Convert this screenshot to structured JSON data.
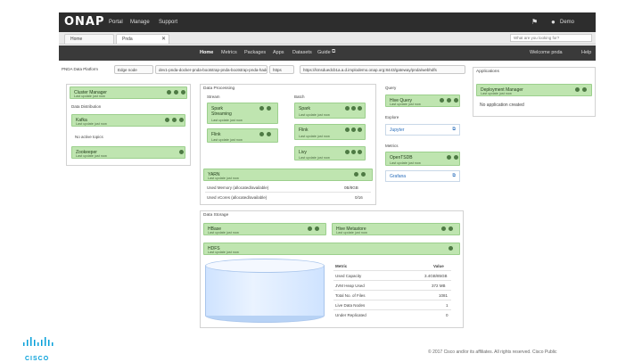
{
  "topbar": {
    "logo": "ONAP",
    "portal": "Portal",
    "manage": "Manage",
    "support": "Support",
    "user": "Demo"
  },
  "tabs": {
    "home": "Home",
    "pnda": "Pnda",
    "search_placeholder": "What are you looking for?"
  },
  "appnav": {
    "items": [
      "Home",
      "Metrics",
      "Packages",
      "Apps",
      "Datasets",
      "Guide"
    ],
    "welcome": "Welcome pnda",
    "help": "Help"
  },
  "envbar": {
    "label": "PNDA Data Platform",
    "edge_node_label": "Edge node",
    "edge_node_value": "dev1-pnda-docker-pnda-bootstrap-pnda-bootstrap-pnda",
    "edge_chip": "dev1-pnda-docker-pnda-bootstrap-pnda-bootstrap-pnda-hadoop-edge",
    "https_label": "https",
    "url": "https://kmsduedcb1a.a.d.implodemo.onap.org:8443/gateway/pnda/webhdfs"
  },
  "left_panel": {
    "cluster_manager": "Cluster Manager",
    "last_update": "Last update just now",
    "data_distribution": "Data Distribution",
    "kafka": "Kafka",
    "no_active_topics": "No active topics",
    "zookeeper": "Zookeeper"
  },
  "data_processing": {
    "title": "Data Processing",
    "stream": "Stream",
    "batch": "Batch",
    "spark_streaming_1": "Spark",
    "spark_streaming_2": "Streaming",
    "flink_stream": "Flink",
    "spark_batch": "Spark",
    "flink_batch": "Flink",
    "livy": "Livy",
    "yarn": "YARN",
    "used_memory": "Used Memory (allocated/available)",
    "used_memory_value": "0B/8GB",
    "used_vcores": "Used vCores (allocated/available)",
    "used_vcores_value": "0/16",
    "last_update": "Last update just now"
  },
  "data_storage": {
    "title": "Data Storage",
    "hbase": "HBase",
    "hive_metastore": "Hive Metastore",
    "hdfs": "HDFS",
    "last_update": "Last update just now",
    "metric_header": "Metric",
    "value_header": "Value",
    "rows": [
      {
        "metric": "Used Capacity",
        "value": "3.4GB/85GB"
      },
      {
        "metric": "JVM Heap Used",
        "value": "372 MB"
      },
      {
        "metric": "Total No. of Files",
        "value": "1081"
      },
      {
        "metric": "Live Data Nodes",
        "value": "1"
      },
      {
        "metric": "Under Replicated",
        "value": "0"
      }
    ]
  },
  "query": {
    "title": "Query",
    "hive_query": "Hive Query",
    "explore": "Explore",
    "jupyter": "Jupyter",
    "metrics": "Metrics",
    "opentsdb": "OpenTSDB",
    "grafana": "Grafana",
    "last_update": "Last update just now"
  },
  "applications": {
    "title": "Applications",
    "deployment_manager": "Deployment Manager",
    "last_update": "Last update just now",
    "no_app": "No application created"
  },
  "footer": {
    "copyright": "© 2017 Cisco and/or its affiliates. All rights reserved. Cisco Public",
    "brand": "CISCO"
  },
  "colors": {
    "card_green": "#bfe5b0",
    "card_border": "#9ccf8d",
    "nav_dark": "#3a3a3a",
    "topbar": "#2d2d2d",
    "link_blue": "#2a6ebb",
    "cisco_blue": "#049fd9"
  }
}
